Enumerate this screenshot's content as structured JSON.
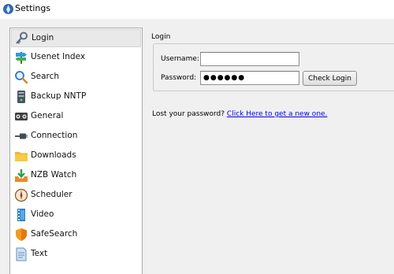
{
  "window": {
    "title": "Settings",
    "icon": "app-globe-icon"
  },
  "sidebar": {
    "selected_index": 0,
    "items": [
      {
        "label": "Login",
        "icon": "key-icon"
      },
      {
        "label": "Usenet Index",
        "icon": "signpost-icon"
      },
      {
        "label": "Search",
        "icon": "magnifier-icon"
      },
      {
        "label": "Backup NNTP",
        "icon": "server-icon"
      },
      {
        "label": "General",
        "icon": "general-settings-icon"
      },
      {
        "label": "Connection",
        "icon": "network-cable-icon"
      },
      {
        "label": "Downloads",
        "icon": "downloads-folder-icon"
      },
      {
        "label": "NZB Watch",
        "icon": "download-tray-icon"
      },
      {
        "label": "Scheduler",
        "icon": "compass-clock-icon"
      },
      {
        "label": "Video",
        "icon": "film-strip-icon"
      },
      {
        "label": "SafeSearch",
        "icon": "shield-icon"
      },
      {
        "label": "Text",
        "icon": "text-document-icon"
      }
    ]
  },
  "login": {
    "section_title": "Login",
    "username_label": "Username:",
    "username_value": "",
    "password_label": "Password:",
    "password_value": "●●●●●●",
    "check_button": "Check Login",
    "lost_prefix": "Lost your password?",
    "lost_link": "Click Here to get a new one."
  },
  "colors": {
    "link": "#0000ee",
    "sidebar_selected": "#e9e9e9",
    "window_bg": "#f0f0f0"
  }
}
